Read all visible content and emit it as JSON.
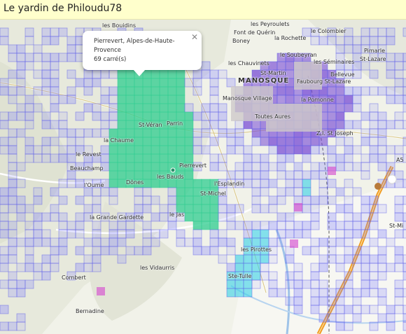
{
  "header": {
    "title": "Le yardin de Philoudu78"
  },
  "popup": {
    "line1": "Pierrevert, Alpes-de-Haute-Provence",
    "line2": "69 carré(s)",
    "close_icon": "close-icon"
  },
  "map": {
    "city_label": "MANOSQUE",
    "places": [
      "les Bouidins",
      "Font de Quérin",
      "les Peyroulets",
      "Boney",
      "la Rochette",
      "le Colombier",
      "le Soubeyran",
      "les Chauvinets",
      "les Séminaires",
      "Pimarle",
      "St-Lazare",
      "St-Martin",
      "Bellevue",
      "Faubourg St-Lazare",
      "Manosque Village",
      "la Pomonne",
      "Toutes Aures",
      "Z.I. St Joseph",
      "St-Véran",
      "Parrin",
      "la Chaume",
      "le Revest",
      "Beauchamp",
      "Pierrevert",
      "les Bauds",
      "Dônes",
      "l'Oume",
      "l'Esplandin",
      "St-Michel",
      "la Grande Gardette",
      "le Jas",
      "les Vidaurris",
      "Combert",
      "les Pirottes",
      "Ste-Tulle",
      "Bernadine",
      "St-Mi",
      "A5"
    ],
    "colors": {
      "visited_square": "#8080ff",
      "own_square": "#2ecc8f",
      "cluster_square": "#7a4fd6",
      "cyan_square": "#35d1e6",
      "magenta_square": "#d64fd0",
      "motorway": "#f09a1e",
      "title_bg": "#ffffcc"
    }
  }
}
